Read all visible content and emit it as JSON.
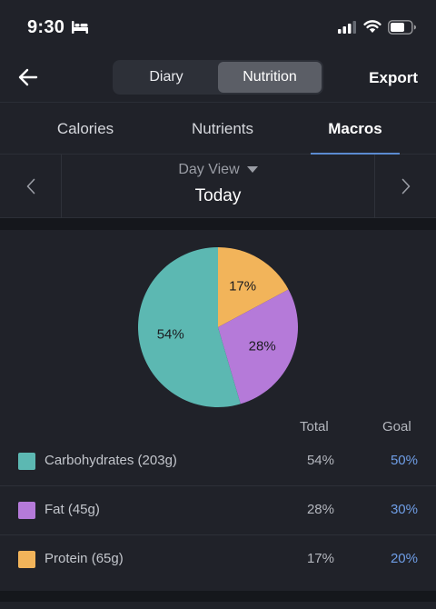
{
  "status": {
    "time": "9:30"
  },
  "nav": {
    "segments": [
      "Diary",
      "Nutrition"
    ],
    "active_segment": "Nutrition",
    "export_label": "Export"
  },
  "tabs": [
    {
      "label": "Calories",
      "active": false
    },
    {
      "label": "Nutrients",
      "active": false
    },
    {
      "label": "Macros",
      "active": true
    }
  ],
  "day": {
    "mode": "Day View",
    "value": "Today"
  },
  "table": {
    "total_header": "Total",
    "goal_header": "Goal"
  },
  "colors": {
    "carbs": "#5cb8b2",
    "fat": "#b57ad9",
    "protein": "#f2b45a",
    "accent": "#5b8bd0"
  },
  "macros": [
    {
      "label": "Carbohydrates (203g)",
      "total": "54%",
      "goal": "50%",
      "color": "#5cb8b2"
    },
    {
      "label": "Fat (45g)",
      "total": "28%",
      "goal": "30%",
      "color": "#b57ad9"
    },
    {
      "label": "Protein (65g)",
      "total": "17%",
      "goal": "20%",
      "color": "#f2b45a"
    }
  ],
  "chart_data": {
    "type": "pie",
    "slices": [
      {
        "name": "Protein",
        "value": 17,
        "label": "17%",
        "color": "#f2b45a"
      },
      {
        "name": "Fat",
        "value": 28,
        "label": "28%",
        "color": "#b57ad9"
      },
      {
        "name": "Carbohydrates",
        "value": 54,
        "label": "54%",
        "color": "#5cb8b2"
      }
    ],
    "legend": "below"
  }
}
